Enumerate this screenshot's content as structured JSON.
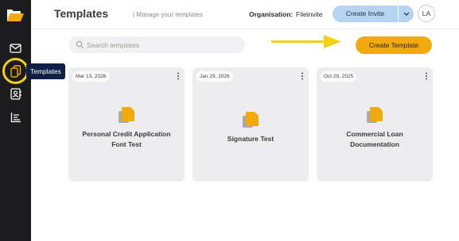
{
  "sidebar": {
    "tooltip": "Templates",
    "items": [
      {
        "icon": "mail-icon"
      },
      {
        "icon": "templates-icon"
      },
      {
        "icon": "contacts-icon"
      },
      {
        "icon": "reports-icon"
      }
    ]
  },
  "header": {
    "title": "Templates",
    "subtitle": "| Manage your templates",
    "org_label": "Organisation:",
    "org_name": "Fileinvite",
    "invite_label": "Create Invite",
    "avatar_initials": "LA"
  },
  "toolbar": {
    "search_placeholder": "Search templates",
    "create_label": "Create Template"
  },
  "templates": [
    {
      "date": "Mar 13, 2026",
      "name_line1": "Personal Credit Application",
      "name_line2": "Font Test"
    },
    {
      "date": "Jan 29, 2026",
      "name_line1": "Signature Test",
      "name_line2": ""
    },
    {
      "date": "Oct 29, 2025",
      "name_line1": "Commercial Loan",
      "name_line2": "Documentation"
    }
  ],
  "colors": {
    "accent": "#f2a90e",
    "annotation_yellow": "#f3d11a",
    "sidebar_bg": "#1c1c1f",
    "invite_button": "#b5d4ef",
    "card_bg": "#ededf0"
  }
}
